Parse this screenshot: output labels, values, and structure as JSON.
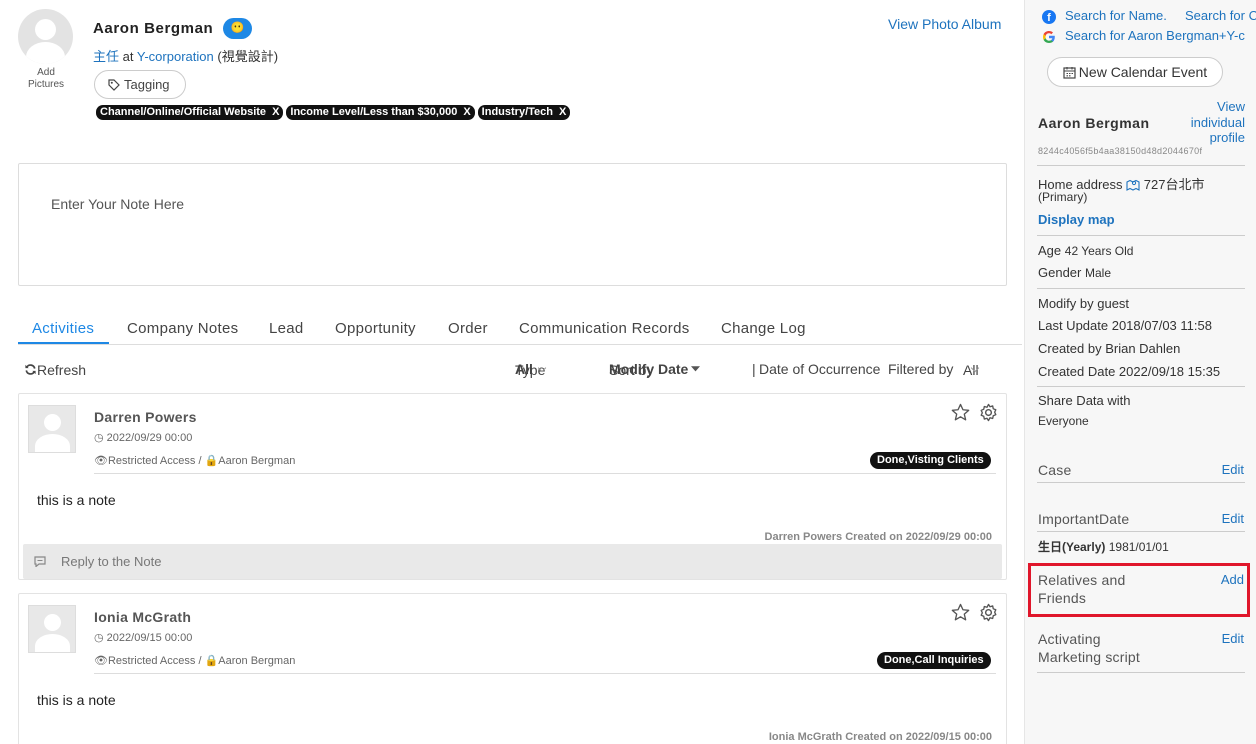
{
  "profile": {
    "name": "Aaron Bergman",
    "add_pictures_line1": "Add",
    "add_pictures_line2": "Pictures",
    "badge": "😶",
    "title": "主任",
    "at": "at",
    "company": "Y-corporation",
    "dept": "(視覺設計)",
    "tagging_label": "Tagging",
    "view_photo_album": "View Photo Album",
    "tags": [
      {
        "label": "Channel/Online/Official Website",
        "remove": "X"
      },
      {
        "label": "Income Level/Less than $30,000",
        "remove": "X"
      },
      {
        "label": "Industry/Tech",
        "remove": "X"
      }
    ]
  },
  "note": {
    "placeholder": "Enter Your Note Here"
  },
  "tabs": [
    "Activities",
    "Company Notes",
    "Lead",
    "Opportunity",
    "Order",
    "Communication Records",
    "Change Log"
  ],
  "toolbar": {
    "refresh": "Refresh",
    "type_label": "Type",
    "type_value": "All",
    "sort_label": "Sort by",
    "sort_value": "Modify Date",
    "divider": "|",
    "date_occurrence": "Date of Occurrence",
    "filtered_label": "Filtered by",
    "filtered_value": "All"
  },
  "activities": [
    {
      "author": "Darren Powers",
      "date": "2022/09/29 00:00",
      "access": "Restricted Access /",
      "owner": "Aaron Bergman",
      "status": "Done,Visting Clients",
      "body": "this is a note",
      "created": "Darren Powers Created on 2022/09/29 00:00",
      "reply": "Reply to the Note"
    },
    {
      "author": "Ionia McGrath",
      "date": "2022/09/15 00:00",
      "access": "Restricted Access /",
      "owner": "Aaron Bergman",
      "status": "Done,Call Inquiries",
      "body": "this is a note",
      "created": "Ionia McGrath Created on 2022/09/15 00:00"
    }
  ],
  "sidebar": {
    "search_name": "Search for Name.",
    "search_for": "Search for C",
    "search_full": "Search for Aaron Bergman+Y-c",
    "calendar_btn": "New Calendar Event",
    "name": "Aaron Bergman",
    "view_profile": "View individual profile",
    "id": "8244c4056f5b4aa38150d48d2044670f",
    "home_address_label": "Home address",
    "home_address_value": "727台北市",
    "primary": "(Primary)",
    "display_map": "Display map",
    "age_label": "Age",
    "age_value": "42 Years Old",
    "gender_label": "Gender",
    "gender_value": "Male",
    "modify_by": "Modify by guest",
    "last_update": "Last Update 2018/07/03 11:58",
    "created_by": "Created by Brian Dahlen",
    "created_date": "Created Date 2022/09/18 15:35",
    "share_label": "Share Data with",
    "share_value": "Everyone",
    "case_label": "Case",
    "case_action": "Edit",
    "important_label": "ImportantDate",
    "important_action": "Edit",
    "birthday_label": "生日(Yearly)",
    "birthday_value": "1981/01/01",
    "relatives_line1": "Relatives and",
    "relatives_line2": "Friends",
    "relatives_action": "Add",
    "marketing_line1": "Activating",
    "marketing_line2": "Marketing script",
    "marketing_action": "Edit"
  },
  "colors": {
    "accent": "#1e88e5",
    "highlight": "#e0162b",
    "tag_bg": "#111111"
  }
}
